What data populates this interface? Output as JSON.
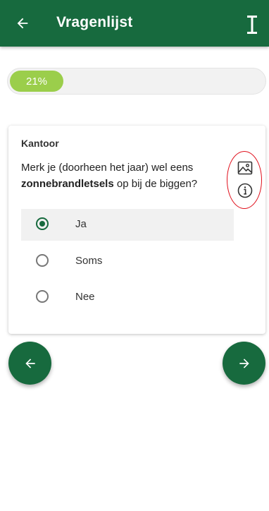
{
  "appbar": {
    "title": "Vragenlijst",
    "back_icon": "arrow-left-icon",
    "right_icon": "text-cursor-icon",
    "color": "#176a3e"
  },
  "progress": {
    "label": "21%",
    "value": 0.21,
    "fill_color": "#9bce4b"
  },
  "question": {
    "category": "Kantoor",
    "text_part1": "Merk je (doorheen het jaar) wel eens ",
    "text_bold": "zonnebrandletsels",
    "text_part2": " op bij de biggen?",
    "icons": [
      "image-icon",
      "info-icon"
    ]
  },
  "options": [
    {
      "label": "Ja",
      "selected": true
    },
    {
      "label": "Soms",
      "selected": false
    },
    {
      "label": "Nee",
      "selected": false
    }
  ],
  "navigation": {
    "prev_icon": "arrow-left-icon",
    "next_icon": "arrow-right-icon"
  },
  "annotation": {
    "color": "#e0101c"
  }
}
